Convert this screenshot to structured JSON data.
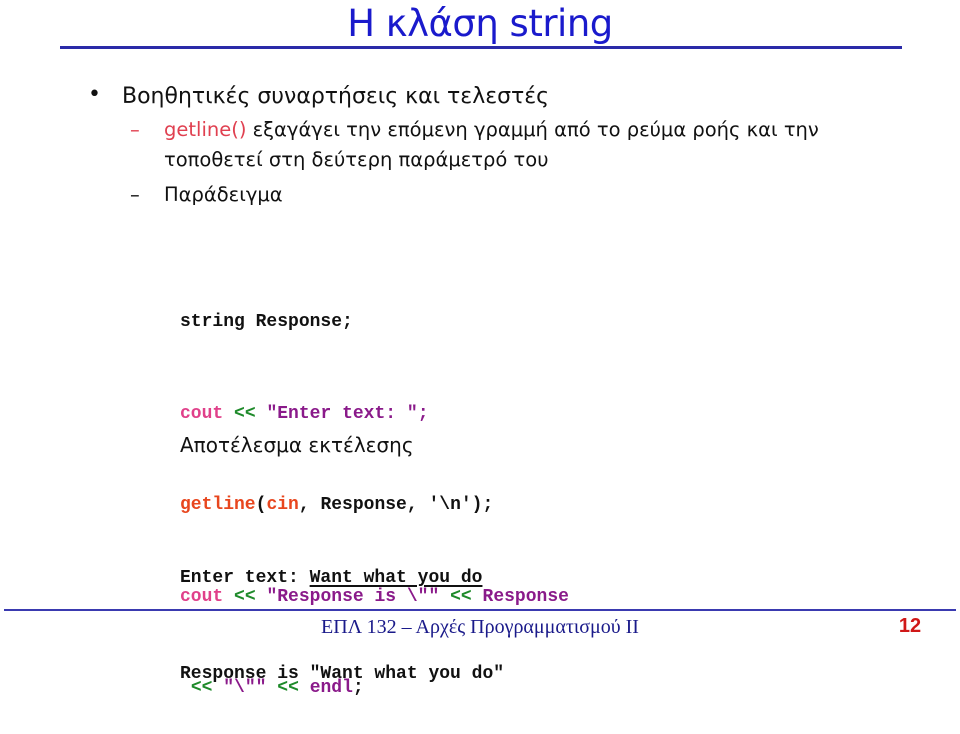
{
  "slide": {
    "title": "Η κλάση string",
    "bullets": [
      {
        "marker": "•",
        "text": "Βοηθητικές συναρτήσεις και τελεστές",
        "subitems": [
          {
            "marker": "–",
            "highlight": "getline()",
            "text": "  εξαγάγει την επόμενη γραμμή από το ρεύμα ροής και την",
            "continuation": "τοποθετεί στη δεύτερη παράμετρό του"
          },
          {
            "marker": "–",
            "text": "Παράδειγμα"
          }
        ]
      }
    ],
    "code": {
      "line1": {
        "kw": "string",
        "rest": " Response;"
      },
      "line2": {
        "cout": "cout",
        "sp1": " ",
        "op": "<<",
        "sp2": " ",
        "str": "\"Enter text: \"",
        "end": ";"
      },
      "line3": {
        "fn": "getline",
        "paren": "(",
        "cin": "cin",
        "rest": ", Response, '\\n');"
      },
      "line4": {
        "cout": "cout",
        "sp1": " ",
        "op1": "<<",
        "sp2": " ",
        "str": "\"Response is \\\"\"",
        "sp3": " ",
        "op2": "<<",
        "sp4": " ",
        "var": "Response"
      },
      "line5": {
        "lead": " ",
        "op1": "<<",
        "sp1": " ",
        "str": "\"\\\"″",
        "sp2": " ",
        "op2": "<<",
        "sp3": " ",
        "endl": "endl",
        "end": ";"
      }
    },
    "result_label": "Αποτέλεσμα εκτέλεσης",
    "output": {
      "line1_prompt": "Enter text: ",
      "line1_input": "Want what you do",
      "line2": "Response is \"Want what you do\""
    },
    "footer": {
      "course": "ΕΠΛ 132 – Αρχές Προγραμματισμού ΙΙ",
      "page_number": "12"
    }
  },
  "colors": {
    "title": "#1a1acc",
    "highlight": "#e04050",
    "code_cout": "#e0408a",
    "code_operator": "#1e8a2a",
    "code_string": "#8a1a8a",
    "code_function": "#e8461e",
    "footer_text": "#1a1a8a",
    "page_number": "#d01818"
  }
}
